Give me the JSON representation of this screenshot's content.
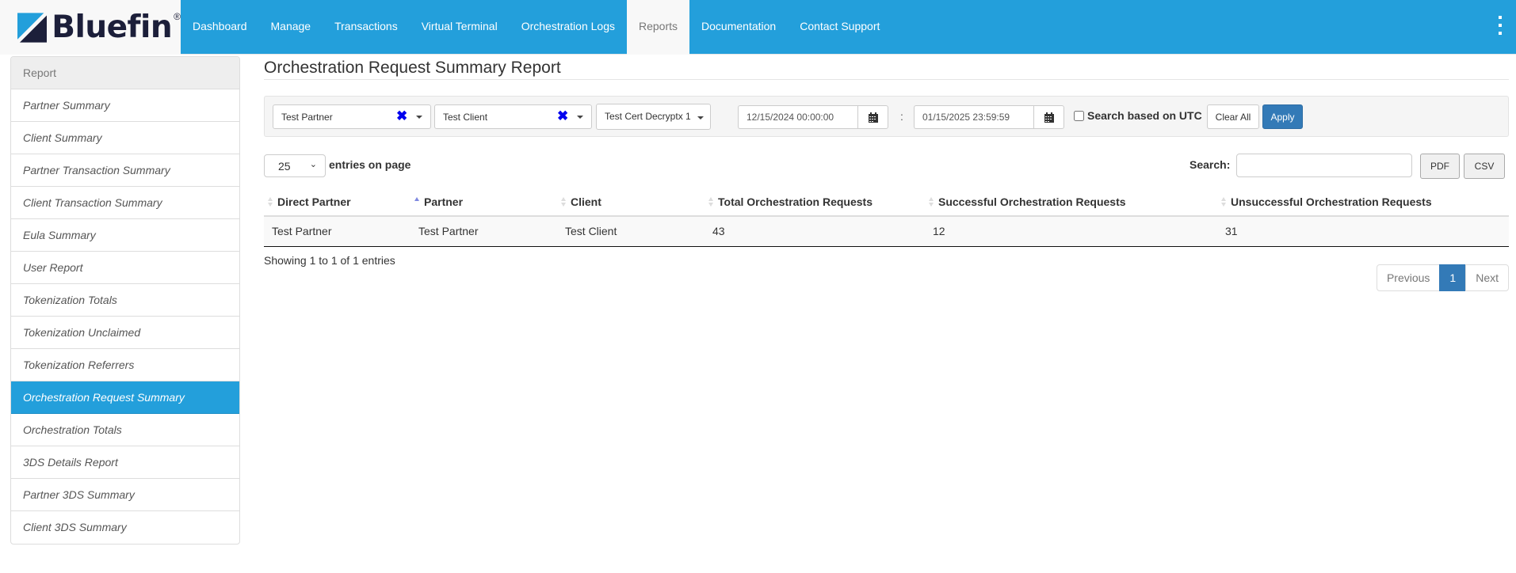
{
  "brand": {
    "name": "Bluefin",
    "reg_mark": "®"
  },
  "nav": {
    "items": [
      {
        "label": "Dashboard",
        "active": false
      },
      {
        "label": "Manage",
        "active": false
      },
      {
        "label": "Transactions",
        "active": false
      },
      {
        "label": "Virtual Terminal",
        "active": false
      },
      {
        "label": "Orchestration Logs",
        "active": false
      },
      {
        "label": "Reports",
        "active": true
      },
      {
        "label": "Documentation",
        "active": false
      },
      {
        "label": "Contact Support",
        "active": false
      }
    ],
    "menu_icon": "kebab-menu-icon"
  },
  "sidebar": {
    "heading": "Report",
    "items": [
      {
        "label": "Partner Summary"
      },
      {
        "label": "Client Summary"
      },
      {
        "label": "Partner Transaction Summary"
      },
      {
        "label": "Client Transaction Summary"
      },
      {
        "label": "Eula Summary"
      },
      {
        "label": "User Report"
      },
      {
        "label": "Tokenization Totals"
      },
      {
        "label": "Tokenization Unclaimed"
      },
      {
        "label": "Tokenization Referrers"
      },
      {
        "label": "Orchestration Request Summary",
        "active": true
      },
      {
        "label": "Orchestration Totals"
      },
      {
        "label": "3DS Details Report"
      },
      {
        "label": "Partner 3DS Summary"
      },
      {
        "label": "Client 3DS Summary"
      }
    ]
  },
  "page": {
    "title": "Orchestration Request Summary Report"
  },
  "filters": {
    "partner": {
      "value": "Test Partner",
      "clear_icon": "✖"
    },
    "client": {
      "value": "Test Client",
      "clear_icon": "✖"
    },
    "cert": {
      "value": "Test Cert Decryptx 1"
    },
    "date_from": "12/15/2024 00:00:00",
    "date_separator": ":",
    "date_to": "01/15/2025 23:59:59",
    "utc_label": "Search based on UTC",
    "utc_checked": false,
    "clear_label": "Clear All",
    "apply_label": "Apply"
  },
  "table_controls": {
    "page_length": "25",
    "page_length_label": "entries on page",
    "search_label": "Search:",
    "search_value": "",
    "pdf_label": "PDF",
    "csv_label": "CSV"
  },
  "table": {
    "columns": [
      {
        "label": "Direct Partner",
        "sort": "none"
      },
      {
        "label": "Partner",
        "sort": "asc"
      },
      {
        "label": "Client",
        "sort": "none"
      },
      {
        "label": "Total Orchestration Requests",
        "sort": "none"
      },
      {
        "label": "Successful Orchestration Requests",
        "sort": "none"
      },
      {
        "label": "Unsuccessful Orchestration Requests",
        "sort": "none"
      }
    ],
    "rows": [
      [
        "Test Partner",
        "Test Partner",
        "Test Client",
        "43",
        "12",
        "31"
      ]
    ]
  },
  "footer": {
    "info": "Showing 1 to 1 of 1 entries",
    "pagination": {
      "previous": "Previous",
      "current": "1",
      "next": "Next"
    }
  },
  "colors": {
    "nav_bg": "#239fdb",
    "active_item": "#239fdb",
    "primary_button": "#337ab7",
    "clear_x": "#0000ee",
    "logo_dark": "#1c1f3a"
  }
}
